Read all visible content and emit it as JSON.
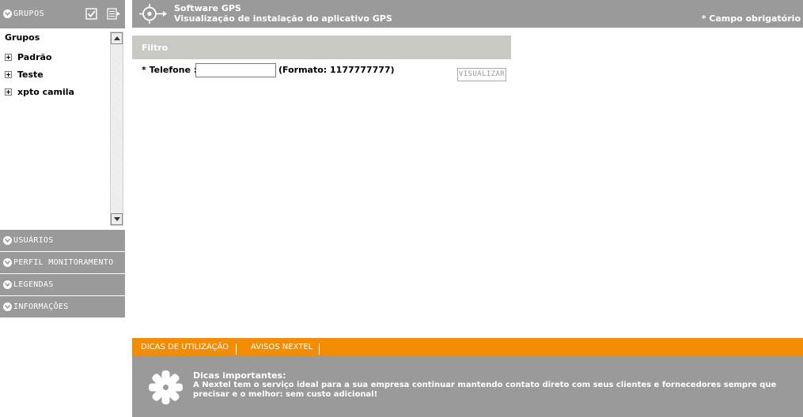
{
  "sidebar": {
    "header": {
      "title": "GRUPOS",
      "check_icon": "checkbox-checked-icon",
      "list_icon": "list-export-icon"
    },
    "tree": {
      "root_label": "Grupos",
      "items": [
        {
          "label": "Padrão"
        },
        {
          "label": "Teste"
        },
        {
          "label": "xpto camila"
        }
      ]
    },
    "sections": [
      {
        "title": "USUÁRIOS"
      },
      {
        "title": "PERFIL MONITORAMENTO"
      },
      {
        "title": "LEGENDAS"
      },
      {
        "title": "INFORMAÇÕES"
      }
    ]
  },
  "header": {
    "app_title": "Software GPS",
    "page_subtitle": "Visualização de instalação do aplicativo GPS",
    "required_note": "* Campo obrigatório",
    "icon": "gps-target-icon"
  },
  "filter": {
    "section_label": "Filtro",
    "phone_label": "* Telefone :",
    "phone_value": "",
    "format_hint": "(Formato: 1177777777)",
    "submit_label": "VISUALIZAR"
  },
  "footer": {
    "tabs": [
      {
        "label": "DICAS DE UTILIZAÇÃO"
      },
      {
        "label": "AVISOS NEXTEL"
      }
    ],
    "tips": {
      "title": "Dicas importantes:",
      "text": "A Nextel tem o serviço ideal para a sua empresa continuar mantendo contato direto com seus clientes e fornecedores sempre que precisar e o melhor: sem custo adicional!",
      "icon": "asterisk-icon"
    }
  },
  "colors": {
    "panel_gray": "#9a9a9a",
    "filter_gray": "#c8c8c4",
    "accent_orange": "#f28c00"
  }
}
